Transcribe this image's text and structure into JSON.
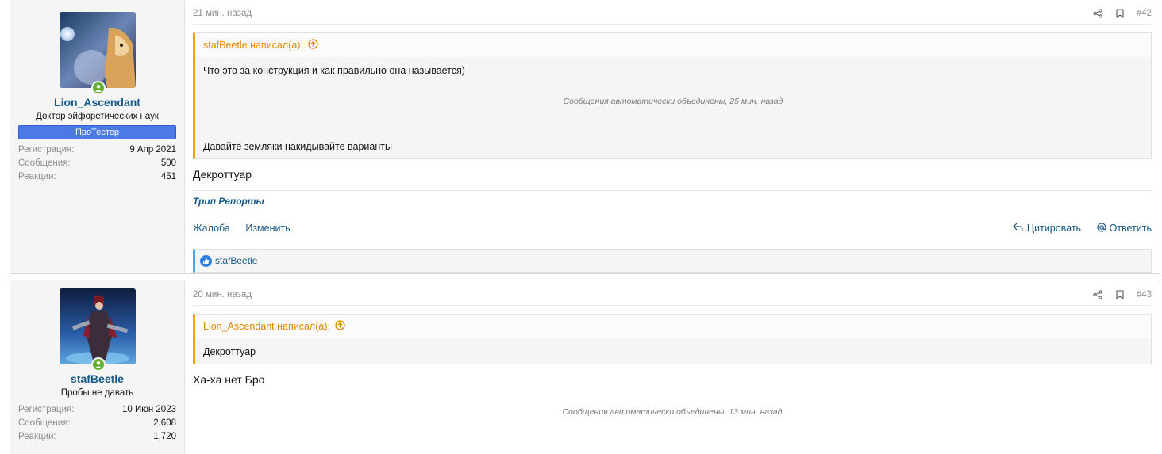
{
  "posts": [
    {
      "username": "Lion_Ascendant",
      "user_title": "Доктор эйфоретических наук",
      "banner": "ПроТестер",
      "stats": [
        {
          "label": "Регистрация:",
          "value": "9 Апр 2021"
        },
        {
          "label": "Сообщения:",
          "value": "500"
        },
        {
          "label": "Реакции:",
          "value": "451"
        }
      ],
      "date": "21 мин. назад",
      "number": "#42",
      "quote_author": "stafBeetle написал(а):",
      "quote_line1": "Что это за конструкция и как правильно она называется)",
      "quote_merged": "Сообщения автоматически объединены, 25 мин. назад",
      "quote_line2": "Давайте земляки накидывайте варианты",
      "message": "Декроттуар",
      "signature": "Трип Репорты",
      "actions": {
        "report": "Жалоба",
        "edit": "Изменить",
        "quote": "Цитировать",
        "reply": "Ответить"
      },
      "reaction_user": "stafBeetle"
    },
    {
      "username": "stafBeetle",
      "user_title": "Пробы не давать",
      "stats": [
        {
          "label": "Регистрация:",
          "value": "10 Июн 2023"
        },
        {
          "label": "Сообщения:",
          "value": "2,608"
        },
        {
          "label": "Реакции:",
          "value": "1,720"
        }
      ],
      "date": "20 мин. назад",
      "number": "#43",
      "quote_author": "Lion_Ascendant написал(а):",
      "quote_line1": "Декроттуар",
      "message": "Ха-ха нет Бро",
      "merged": "Сообщения автоматически объединены, 13 мин. назад"
    }
  ],
  "colors": {
    "link": "#185886",
    "quote_accent": "#f0a400",
    "online": "#63b132",
    "banner_bg": "#4b79e5"
  }
}
